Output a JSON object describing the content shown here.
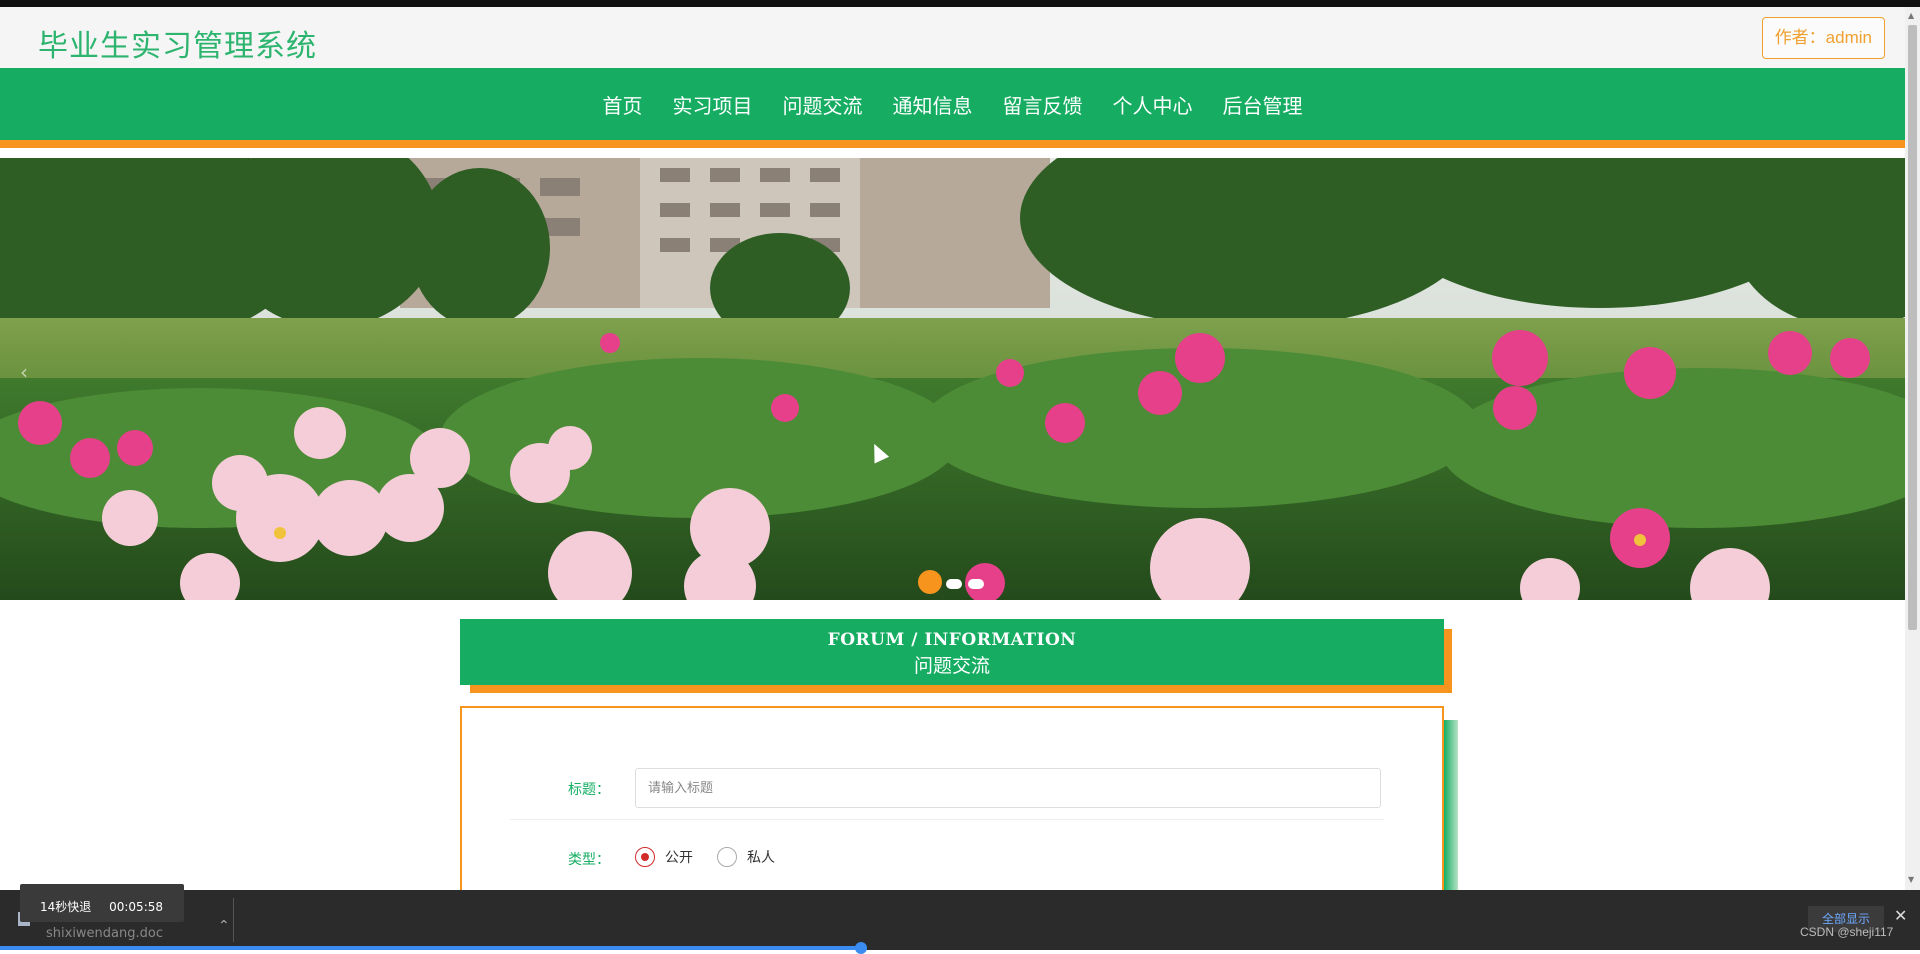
{
  "header": {
    "site_title": "毕业生实习管理系统",
    "author_label": "作者：admin"
  },
  "nav": {
    "items": [
      {
        "label": "首页"
      },
      {
        "label": "实习项目"
      },
      {
        "label": "问题交流"
      },
      {
        "label": "通知信息"
      },
      {
        "label": "留言反馈"
      },
      {
        "label": "个人中心"
      },
      {
        "label": "后台管理"
      }
    ]
  },
  "carousel": {
    "slide_count": 3,
    "active_index": 0
  },
  "section": {
    "title_en": "FORUM / INFORMATION",
    "title_cn": "问题交流"
  },
  "form": {
    "title_label": "标题：",
    "title_placeholder": "请输入标题",
    "type_label": "类型：",
    "type_options": [
      {
        "label": "公开",
        "selected": true
      },
      {
        "label": "私人",
        "selected": false
      }
    ]
  },
  "download_bar": {
    "file_name": "shixiwendang.doc",
    "tooltip_label": "14秒快退",
    "tooltip_time": "00:05:58",
    "show_all_label": "全部显示",
    "close_icon": "close-icon"
  },
  "watermark": "CSDN @sheji117",
  "colors": {
    "brand_green": "#16ad63",
    "accent_orange": "#f7941d",
    "title_green": "#2db56f",
    "radio_red": "#d12b2b"
  }
}
